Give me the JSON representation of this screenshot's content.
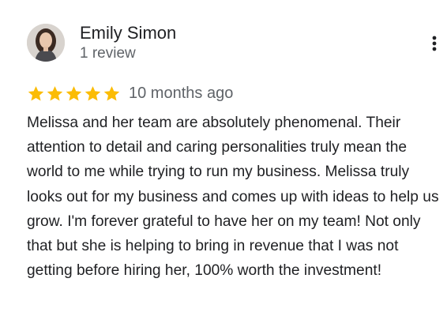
{
  "reviewer": {
    "name": "Emily Simon",
    "review_count": "1 review"
  },
  "rating": {
    "stars": 5,
    "max": 5,
    "star_color": "#fbbc04",
    "date": "10 months ago"
  },
  "review": {
    "text": "Melissa and her team are absolutely phenomenal. Their attention to detail and caring personalities truly mean the world to me while trying to run my business. Melissa truly looks out for my business and comes up with ideas to help us grow. I'm forever grateful to have her on my team! Not only that but she is helping to bring in revenue that I was not getting before hiring her, 100% worth the investment!"
  },
  "icons": {
    "menu": "more-vert-icon",
    "star": "star-icon"
  }
}
